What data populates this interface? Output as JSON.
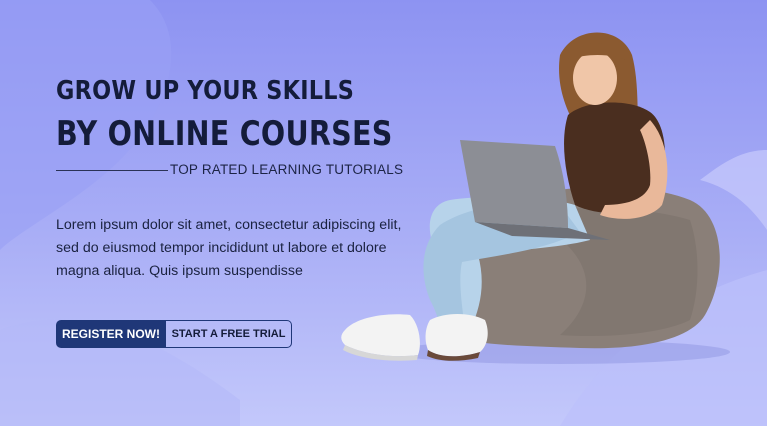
{
  "banner": {
    "headline_line1": "GROW UP YOUR SKILLS",
    "headline_line2": "BY ONLINE COURSES",
    "tagline": "TOP RATED LEARNING TUTORIALS",
    "description": "Lorem ipsum dolor sit amet, consectetur adipiscing elit, sed do eiusmod tempor incididunt ut labore et dolore magna aliqua. Quis ipsum suspendisse",
    "register_label": "REGISTER NOW!",
    "trial_label": "START A FREE TRIAL"
  },
  "colors": {
    "background": "#8d93f2",
    "headline": "#141c3a",
    "primary_button": "#1f3778",
    "beanbag": "#8a7f78",
    "shirt": "#4a2e1f",
    "jeans": "#b7d3ea"
  },
  "hero_image": {
    "subject": "girl-on-beanbag-with-laptop"
  }
}
